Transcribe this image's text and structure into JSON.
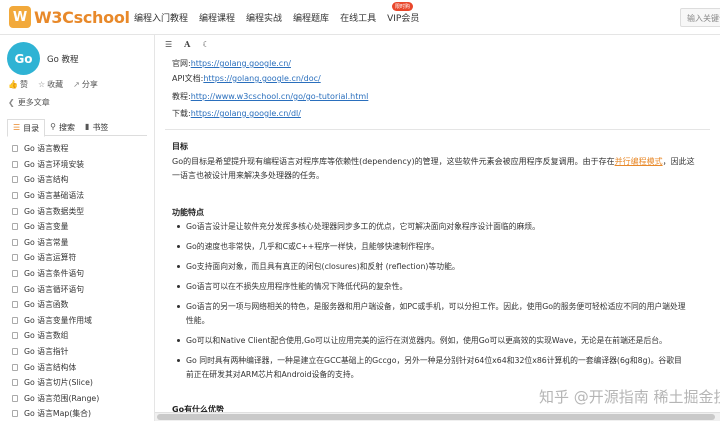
{
  "header": {
    "logo_mark": "W",
    "logo_text": "W3Cschool",
    "nav": [
      "编程入门教程",
      "编程课程",
      "编程实战",
      "编程题库",
      "在线工具",
      "VIP会员"
    ],
    "vip_badge": "限时购",
    "search_placeholder": "输入关键词"
  },
  "sidebar": {
    "course_logo": "Go",
    "course_title": "Go 教程",
    "actions": [
      {
        "icon": "thumb-up-icon",
        "glyph": "👍",
        "label": "赞"
      },
      {
        "icon": "star-icon",
        "glyph": "☆",
        "label": "收藏"
      },
      {
        "icon": "share-icon",
        "glyph": "↗",
        "label": "分享"
      }
    ],
    "more": "更多文章",
    "tabs": [
      {
        "icon": "list-icon",
        "glyph": "☰",
        "label": "目录"
      },
      {
        "icon": "search-icon",
        "glyph": "⚲",
        "label": "搜索"
      },
      {
        "icon": "bookmark-icon",
        "glyph": "▮",
        "label": "书签"
      }
    ],
    "toc": [
      "Go 语言教程",
      "Go 语言环境安装",
      "Go 语言结构",
      "Go 语言基础语法",
      "Go 语言数据类型",
      "Go 语言变量",
      "Go 语言常量",
      "Go 语言运算符",
      "Go 语言条件语句",
      "Go 语言循环语句",
      "Go 语言函数",
      "Go 语言变量作用域",
      "Go 语言数组",
      "Go 语言指针",
      "Go 语言结构体",
      "Go 语言切片(Slice)",
      "Go 语言范围(Range)",
      "Go 语言Map(集合)"
    ]
  },
  "toolbar": {
    "icons": [
      {
        "name": "list-icon",
        "glyph": "☰"
      },
      {
        "name": "font-size-icon",
        "glyph": "A"
      },
      {
        "name": "night-mode-icon",
        "glyph": "☾"
      }
    ]
  },
  "links": [
    {
      "label": "官网:",
      "url": "https://golang.google.cn/"
    },
    {
      "label": "API文档:",
      "url": "https://golang.google.cn/doc/"
    },
    {
      "label": "教程:",
      "url": "http://www.w3cschool.cn/go/go-tutorial.html"
    },
    {
      "label": "下载:",
      "url": "https://golang.google.cn/dl/"
    }
  ],
  "goal": {
    "heading": "目标",
    "text_before": "Go的目标是希望提升现有编程语言对程序库等依赖性(dependency)的管理，这些软件元素会被应用程序反复调用。由于存在",
    "link": "并行编程模式",
    "text_after": "，因此这一语言也被设计用来解决多处理器的任务。"
  },
  "features": {
    "heading": "功能特点",
    "items": [
      "Go语言设计是让软件充分发挥多核心处理器同步多工的优点，它可解决面向对象程序设计面临的麻烦。",
      "Go的速度也非常快，几乎和C或C++程序一样快，且能够快速制作程序。",
      "Go支持面向对象，而且具有真正的闭包(closures)和反射 (reflection)等功能。",
      "Go语言可以在不损失应用程序性能的情况下降低代码的复杂性。",
      "Go语言的另一项与网络相关的特色，是服务器和用户端设备，如PC或手机，可以分担工作。因此，使用Go的服务便可轻松适应不同的用户端处理性能。",
      "Go可以和Native Client配合使用,Go可以让应用完美的运行在浏览器内。例如，使用Go可以更高效的实现Wave，无论是在前端还是后台。",
      "Go 同时具有两种编译器，一种是建立在GCC基础上的Gccgo，另外一种是分别针对64位x64和32位x86计算机的一套编译器(6g和8g)。谷歌目前正在研发其对ARM芯片和Android设备的支持。"
    ]
  },
  "next_heading": "Go有什么优势",
  "watermark": "知乎 @开源指南 稀土掘金技术社区"
}
